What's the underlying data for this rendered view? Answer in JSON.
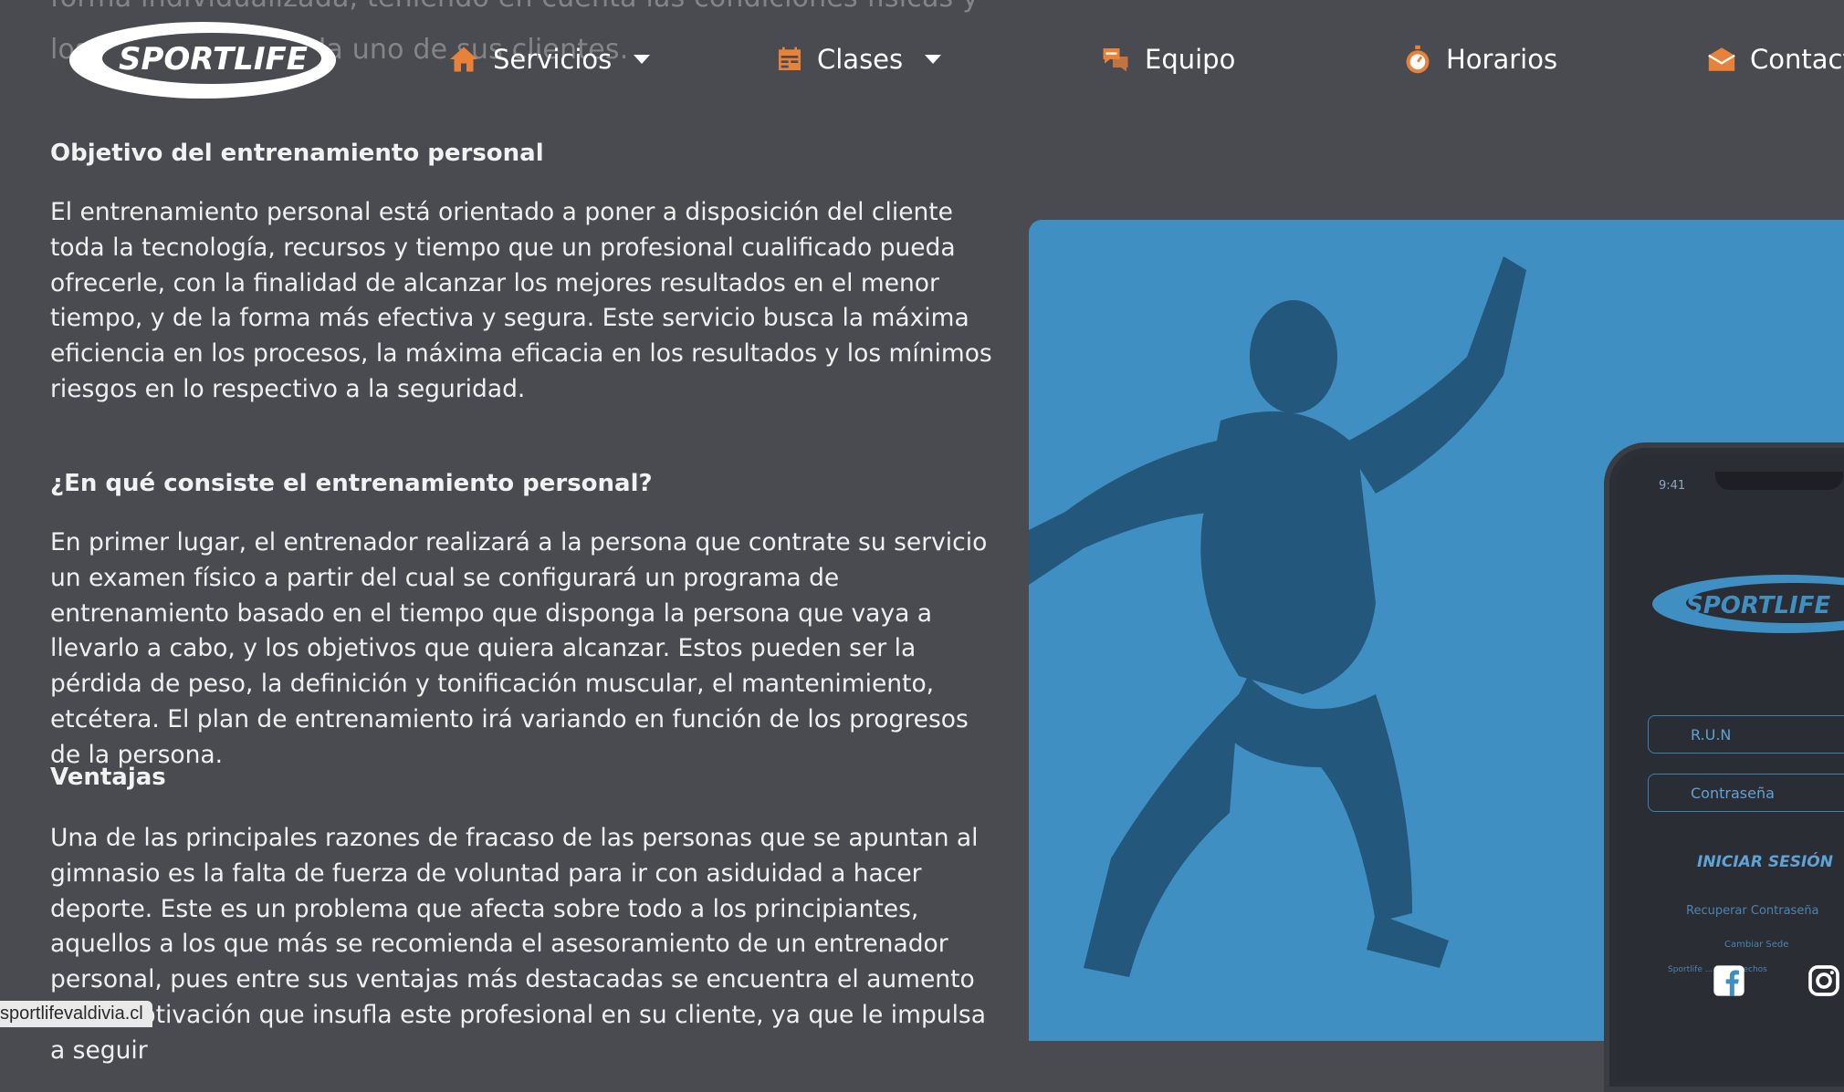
{
  "ghost_text": {
    "line1": "forma individualizada, teniendo en cuenta las condiciones físicas y",
    "line2": "los objetivos de cada uno de sus clientes."
  },
  "brand": {
    "logo_text": "SPORTLIFE",
    "accent": "#e8823a",
    "panel_color": "#3f8fc3"
  },
  "nav": {
    "items": [
      {
        "label": "Servicios",
        "icon": "home-icon",
        "has_dropdown": true
      },
      {
        "label": "Clases",
        "icon": "calendar-icon",
        "has_dropdown": true
      },
      {
        "label": "Equipo",
        "icon": "chat-bubbles-icon",
        "has_dropdown": false
      },
      {
        "label": "Horarios",
        "icon": "stopwatch-icon",
        "has_dropdown": false
      },
      {
        "label": "Contact",
        "icon": "mail-icon",
        "has_dropdown": false
      }
    ]
  },
  "article": {
    "objetivo_heading": "Objetivo del entrenamiento personal",
    "objetivo_text": "El entrenamiento personal está orientado a poner a disposición del cliente toda la tecnología, recursos y tiempo que un profesional cualificado pueda ofrecerle, con la finalidad de alcanzar los mejores resultados en el menor tiempo, y de la forma más efectiva y segura. Este servicio busca la máxima eficiencia en los procesos, la máxima eficacia en los resultados y los mínimos riesgos en lo respectivo a la seguridad.",
    "que_heading": "¿En qué consiste el entrenamiento personal?",
    "que_text": "En primer lugar, el entrenador realizará a la persona que contrate su servicio un examen físico a partir del cual se configurará un programa de entrenamiento basado en el tiempo que disponga la persona que vaya a llevarlo a cabo, y los objetivos que quiera alcanzar. Estos pueden ser la pérdida de peso, la definición y tonificación muscular, el mantenimiento, etcétera. El plan de entrenamiento irá variando en función de los progresos de la persona.",
    "ventajas_heading": "Ventajas",
    "ventajas_text": "Una de las principales razones de fracaso de las personas que se apuntan al gimnasio es la falta de fuerza de voluntad para ir con asiduidad a hacer deporte. Este es un problema que afecta sobre todo a los principiantes, aquellos a los que más se recomienda el asesoramiento de un entrenador personal, pues entre sus ventajas más destacadas se encuentra el aumento de la motivación que insufla este profesional en su cliente, ya que le impulsa a seguir"
  },
  "phone": {
    "time": "9:41",
    "logo_text": "SPORTLIFE",
    "run_placeholder": "R.U.N",
    "password_placeholder": "Contraseña",
    "login_label": "INICIAR SESIÓN",
    "recover_label": "Recuperar Contraseña",
    "change_site_label": "Cambiar Sede",
    "rights_text": "Sportlife ... los derechos"
  },
  "status_bar": {
    "url": "sportlifevaldivia.cl"
  }
}
